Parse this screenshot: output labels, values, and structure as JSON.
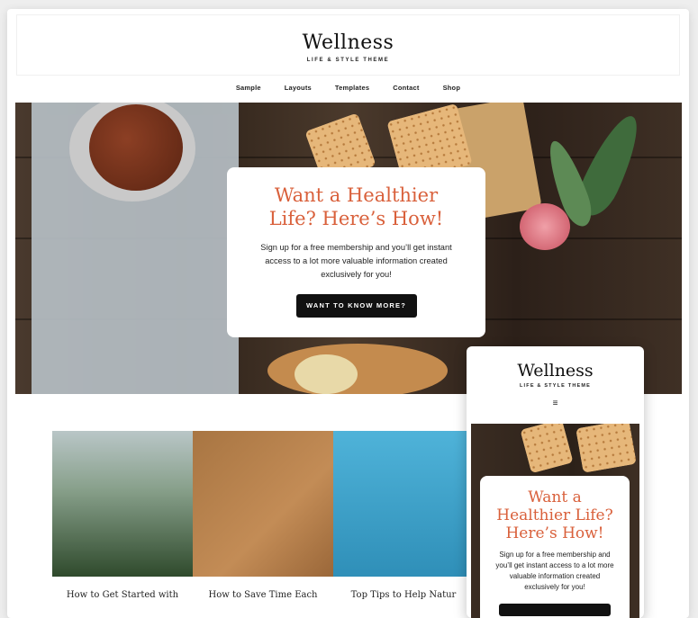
{
  "site": {
    "title": "Wellness",
    "tagline": "LIFE & STYLE THEME"
  },
  "nav": {
    "items": [
      "Sample",
      "Layouts",
      "Templates",
      "Contact",
      "Shop"
    ]
  },
  "hero": {
    "heading_line1": "Want a Healthier",
    "heading_line2": "Life? Here’s How!",
    "body_line1": "Sign up for a free membership and you’ll get instant",
    "body_line2": "access to a lot more valuable information created",
    "body_line3": "exclusively for you!",
    "button_label": "WANT TO KNOW MORE?"
  },
  "posts": [
    {
      "title": "How to Get Started with"
    },
    {
      "title": "How to Save Time Each"
    },
    {
      "title": "Top Tips to Help Natur"
    }
  ],
  "mobile": {
    "title": "Wellness",
    "tagline": "LIFE & STYLE THEME",
    "menu_icon": "≡",
    "heading_line1": "Want a",
    "heading_line2": "Healthier Life?",
    "heading_line3": "Here’s How!",
    "body_line1": "Sign up for a free membership and",
    "body_line2": "you’ll get instant access to a lot more",
    "body_line3": "valuable information created",
    "body_line4": "exclusively for you!"
  },
  "colors": {
    "accent": "#d9603b",
    "button": "#111111"
  }
}
